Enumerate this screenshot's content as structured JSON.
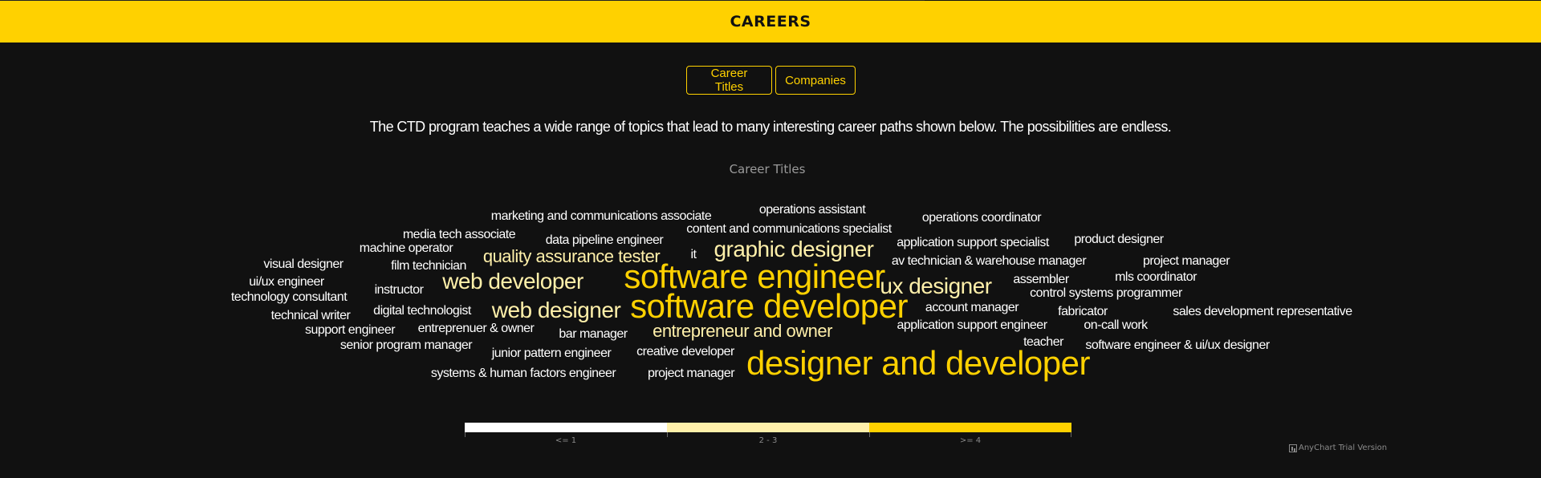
{
  "header": {
    "title": "CAREERS"
  },
  "tabs": [
    {
      "label": "Career Titles"
    },
    {
      "label": "Companies"
    }
  ],
  "intro": "The CTD program teaches a wide range of topics that lead to many interesting career paths shown below. The possibilities are endless.",
  "colors": {
    "accent": "#FFD100",
    "background": "#111111",
    "low": "#FFFFFF",
    "mid": "#FFF0AA",
    "high": "#FFD100"
  },
  "chart_data": {
    "type": "tag-cloud",
    "title": "Career Titles",
    "color_ranges": [
      {
        "label": "<= 1",
        "color": "#FFFFFF"
      },
      {
        "label": "2 - 3",
        "color": "#FFF0AA"
      },
      {
        "label": ">= 4",
        "color": "#FFD100"
      }
    ],
    "words": [
      {
        "text": "designer and developer",
        "value": 6
      },
      {
        "text": "software developer",
        "value": 5
      },
      {
        "text": "software engineer",
        "value": 5
      },
      {
        "text": "graphic designer",
        "value": 3
      },
      {
        "text": "ux designer",
        "value": 3
      },
      {
        "text": "web designer",
        "value": 3
      },
      {
        "text": "web developer",
        "value": 3
      },
      {
        "text": "entrepreneur and owner",
        "value": 2
      },
      {
        "text": "quality assurance tester",
        "value": 2
      },
      {
        "text": "marketing and communications associate",
        "value": 1
      },
      {
        "text": "operations assistant",
        "value": 1
      },
      {
        "text": "operations coordinator",
        "value": 1
      },
      {
        "text": "media tech associate",
        "value": 1
      },
      {
        "text": "content and communications specialist",
        "value": 1
      },
      {
        "text": "data pipeline engineer",
        "value": 1
      },
      {
        "text": "machine operator",
        "value": 1
      },
      {
        "text": "application support specialist",
        "value": 1
      },
      {
        "text": "product designer",
        "value": 1
      },
      {
        "text": "it",
        "value": 1
      },
      {
        "text": "visual designer",
        "value": 1
      },
      {
        "text": "film technician",
        "value": 1
      },
      {
        "text": "av technician & warehouse manager",
        "value": 1
      },
      {
        "text": "project manager",
        "value": 1
      },
      {
        "text": "ui/ux engineer",
        "value": 1
      },
      {
        "text": "assembler",
        "value": 1
      },
      {
        "text": "mls coordinator",
        "value": 1
      },
      {
        "text": "instructor",
        "value": 1
      },
      {
        "text": "technology consultant",
        "value": 1
      },
      {
        "text": "control systems programmer",
        "value": 1
      },
      {
        "text": "account manager",
        "value": 1
      },
      {
        "text": "digital technologist",
        "value": 1
      },
      {
        "text": "fabricator",
        "value": 1
      },
      {
        "text": "sales development representative",
        "value": 1
      },
      {
        "text": "technical writer",
        "value": 1
      },
      {
        "text": "entreprenuer & owner",
        "value": 1
      },
      {
        "text": "application support engineer",
        "value": 1
      },
      {
        "text": "on-call work",
        "value": 1
      },
      {
        "text": "support engineer",
        "value": 1
      },
      {
        "text": "bar manager",
        "value": 1
      },
      {
        "text": "teacher",
        "value": 1
      },
      {
        "text": "senior program manager",
        "value": 1
      },
      {
        "text": "software engineer & ui/ux designer",
        "value": 1
      },
      {
        "text": "junior pattern engineer",
        "value": 1
      },
      {
        "text": "creative developer",
        "value": 1
      },
      {
        "text": "systems & human factors engineer",
        "value": 1
      },
      {
        "text": "project manager",
        "value": 1
      }
    ]
  },
  "credit": "AnyChart Trial Version"
}
